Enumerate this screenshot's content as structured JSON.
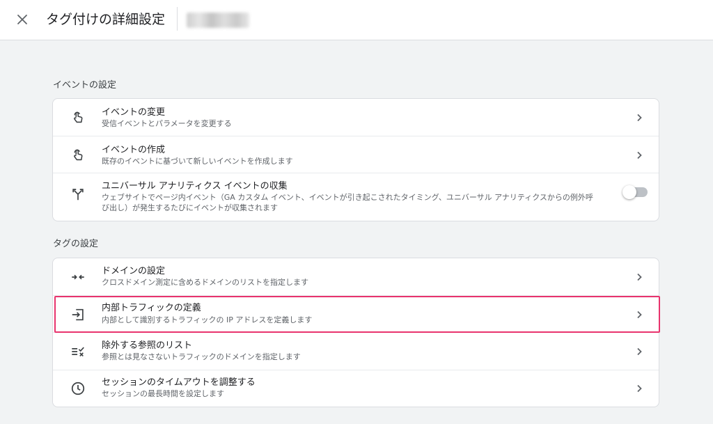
{
  "header": {
    "close_icon": "close-icon",
    "title": "タグ付けの詳細設定"
  },
  "sections": [
    {
      "heading": "イベントの設定",
      "items": [
        {
          "icon": "touch-icon",
          "title": "イベントの変更",
          "description": "受信イベントとパラメータを変更する",
          "control": "chevron"
        },
        {
          "icon": "touch-icon",
          "title": "イベントの作成",
          "description": "既存のイベントに基づいて新しいイベントを作成します",
          "control": "chevron"
        },
        {
          "icon": "merge-arrows-icon",
          "title": "ユニバーサル アナリティクス イベントの収集",
          "description_line1": "ウェブサイトでページ内イベント（GA カスタム イベント、イベントが引き起こされたタイミング、ユニバーサル アナリティクスからの例外呼",
          "description_line2": "び出し）が発生するたびにイベントが収集されます",
          "control": "toggle",
          "toggle_on": false
        }
      ]
    },
    {
      "heading": "タグの設定",
      "items": [
        {
          "icon": "compress-arrows-icon",
          "title": "ドメインの設定",
          "description": "クロスドメイン測定に含めるドメインのリストを指定します",
          "control": "chevron"
        },
        {
          "icon": "input-icon",
          "title": "内部トラフィックの定義",
          "description": "内部として識別するトラフィックの IP アドレスを定義します",
          "control": "chevron",
          "highlighted": true
        },
        {
          "icon": "rule-icon",
          "title": "除外する参照のリスト",
          "description": "参照とは見なさないトラフィックのドメインを指定します",
          "control": "chevron"
        },
        {
          "icon": "clock-icon",
          "title": "セッションのタイムアウトを調整する",
          "description": "セッションの最長時間を設定します",
          "control": "chevron"
        }
      ]
    }
  ],
  "colors": {
    "highlight": "#e8336d",
    "background": "#f1f3f4",
    "card": "#ffffff"
  }
}
